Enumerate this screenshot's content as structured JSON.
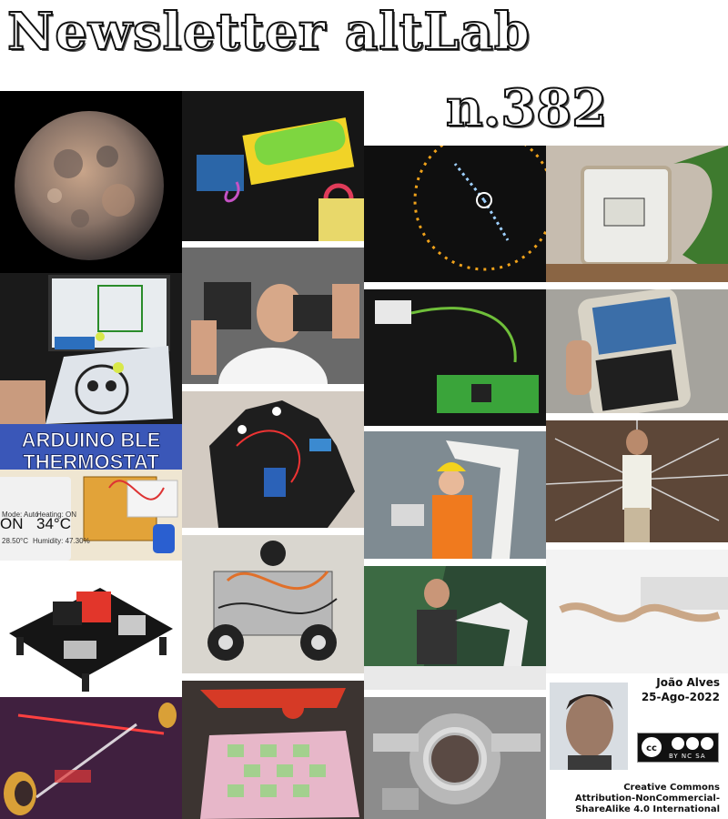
{
  "header": {
    "title": "Newsletter altLab",
    "issue": "n.382"
  },
  "thermostat_tile": {
    "title_line1": "ARDUINO BLE",
    "title_line2": "THERMOSTAT",
    "mode": "Mode: Auto",
    "heating": "Heating: ON",
    "state": "ON",
    "temperature": "34°C",
    "reading": "28.50°C",
    "humidity": "Humidity: 47.30%"
  },
  "footer": {
    "author": "João Alves",
    "date": "25-Ago-2022",
    "cc_badge_text": "BY NC SA",
    "license_line1": "Creative Commons",
    "license_line2": "Attribution-NonCommercial-",
    "license_line3": "ShareAlike 4.0 International"
  }
}
